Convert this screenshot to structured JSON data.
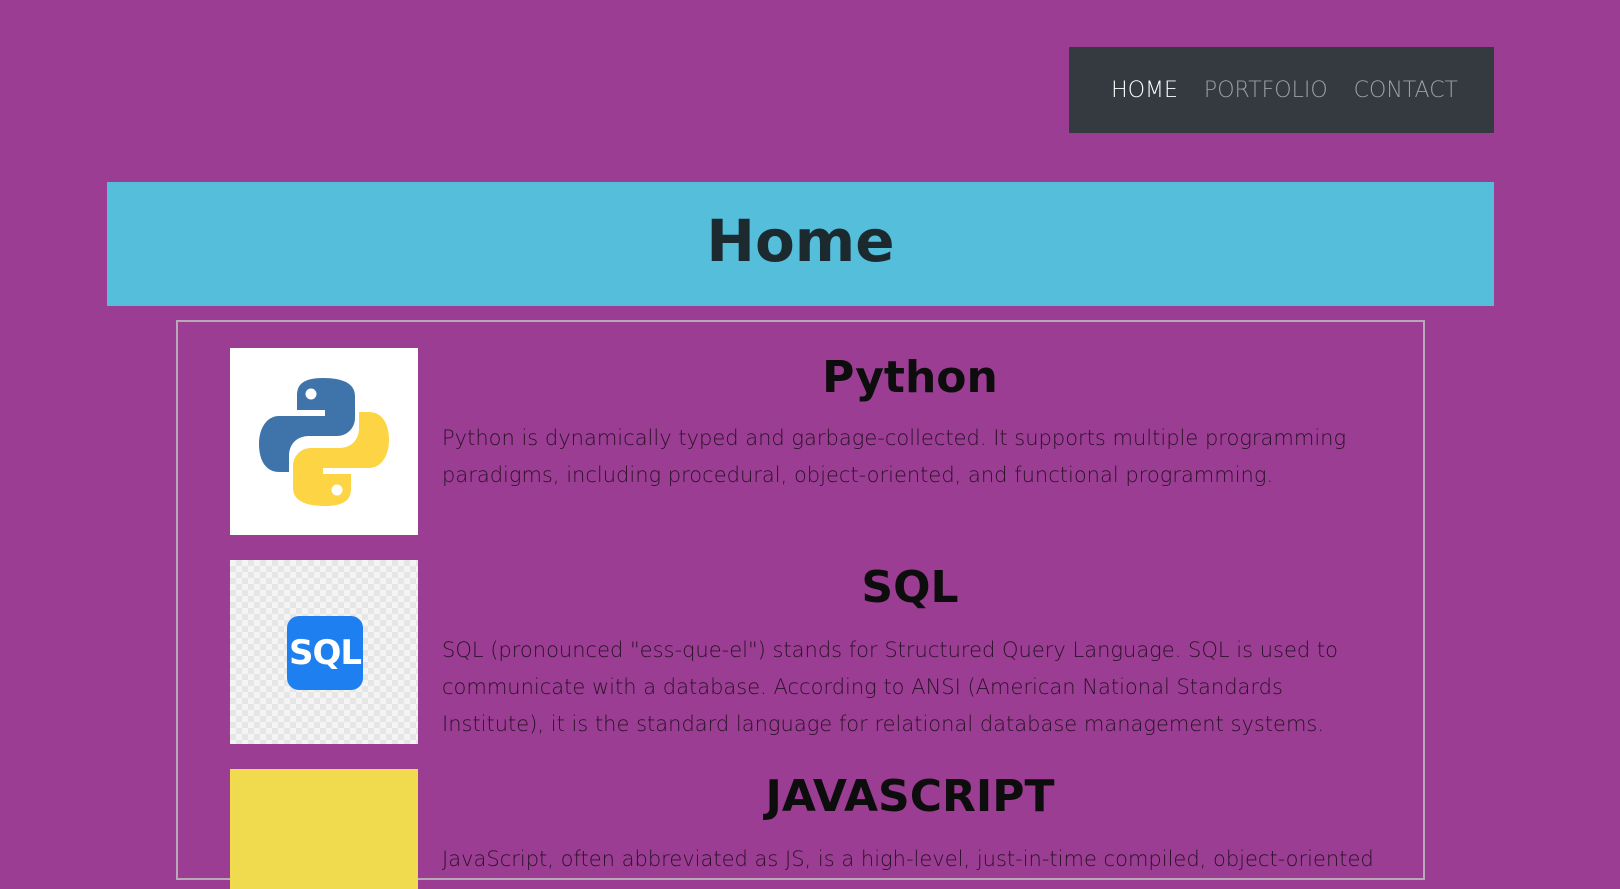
{
  "nav": {
    "items": [
      {
        "label": "HOME",
        "active": true
      },
      {
        "label": "PORTFOLIO",
        "active": false
      },
      {
        "label": "CONTACT",
        "active": false
      }
    ]
  },
  "hero": {
    "title": "Home"
  },
  "skills": [
    {
      "title": "Python",
      "icon": "python-logo-icon",
      "description": "Python is dynamically typed and garbage-collected. It supports multiple programming paradigms, including procedural, object-oriented, and functional programming."
    },
    {
      "title": "SQL",
      "icon": "sql-logo-icon",
      "icon_text": "SQL",
      "description": "SQL (pronounced \"ess-que-el\") stands for Structured Query Language. SQL is used to communicate with a database. According to ANSI (American National Standards Institute), it is the standard language for relational database management systems."
    },
    {
      "title": "JAVASCRIPT",
      "icon": "javascript-logo-icon",
      "description": "JavaScript, often abbreviated as JS, is a high-level, just-in-time compiled, object-oriented"
    }
  ],
  "colors": {
    "page_background": "#9b3d92",
    "navbar_background": "#343a40",
    "hero_background": "#55bedb",
    "sql_badge": "#1e7ff0",
    "javascript_badge": "#f0db4f"
  }
}
